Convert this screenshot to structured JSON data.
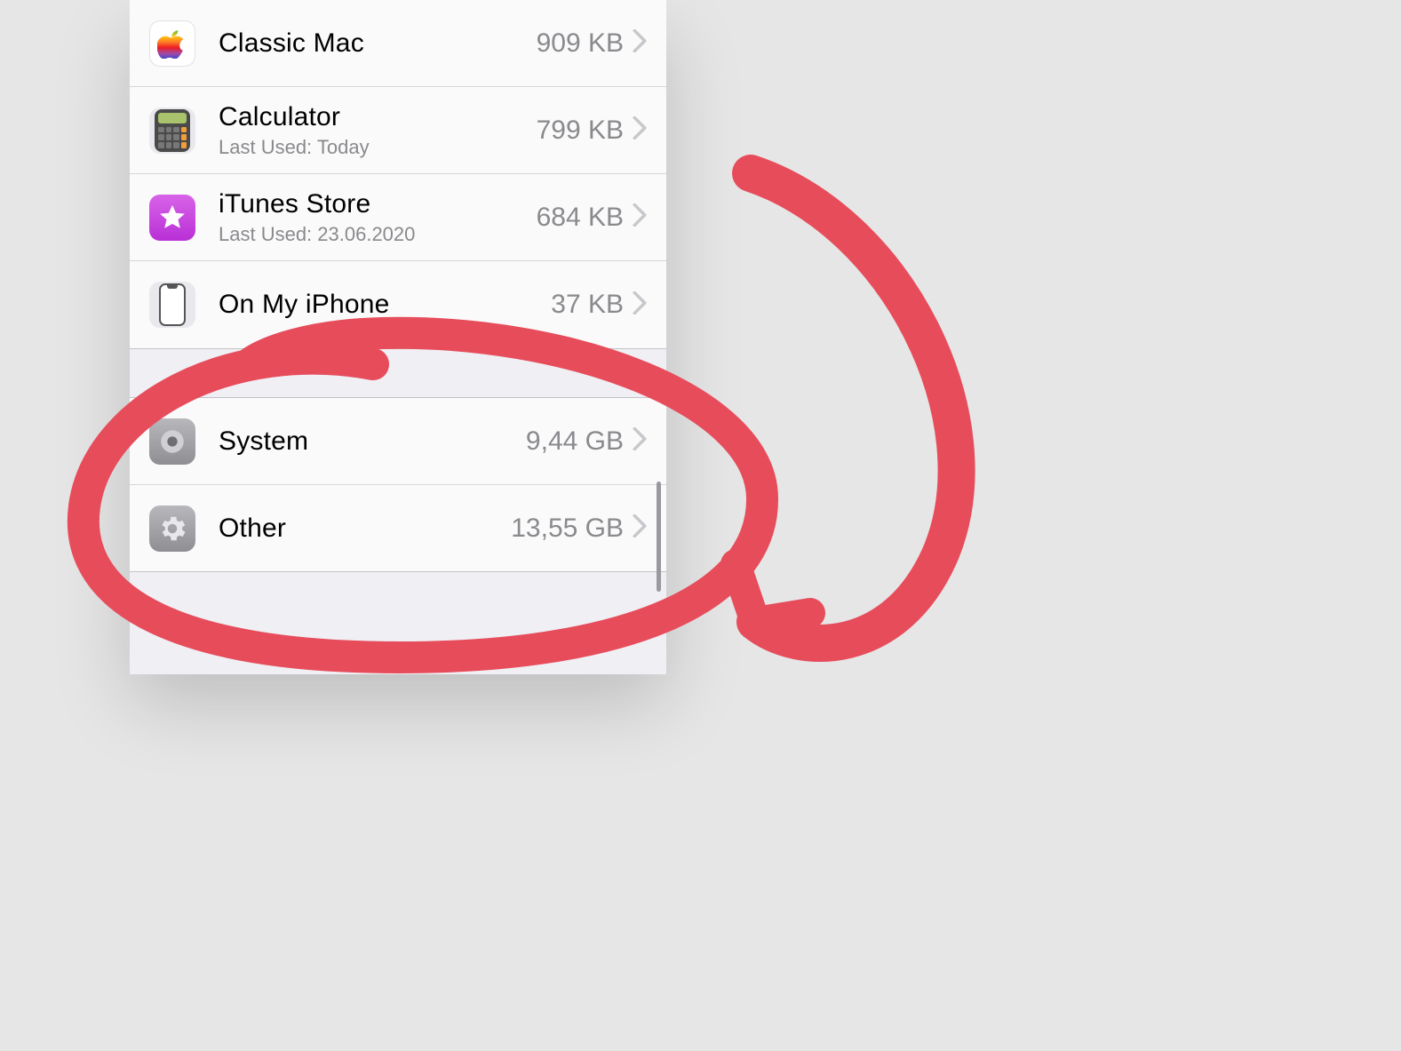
{
  "storage": {
    "apps": [
      {
        "name": "Classic Mac",
        "subtitle": "",
        "size": "909 KB",
        "icon": "classic-mac"
      },
      {
        "name": "Calculator",
        "subtitle": "Last Used: Today",
        "size": "799 KB",
        "icon": "calculator"
      },
      {
        "name": "iTunes Store",
        "subtitle": "Last Used: 23.06.2020",
        "size": "684 KB",
        "icon": "itunes-store"
      },
      {
        "name": "On My iPhone",
        "subtitle": "",
        "size": "37 KB",
        "icon": "on-my-iphone"
      }
    ],
    "system_group": [
      {
        "name": "System",
        "size": "9,44 GB",
        "icon": "system"
      },
      {
        "name": "Other",
        "size": "13,55 GB",
        "icon": "other"
      }
    ]
  },
  "annotation": {
    "color": "#e74c5b",
    "kind": "circle-and-curved-arrow",
    "highlights": [
      "System",
      "Other"
    ]
  }
}
